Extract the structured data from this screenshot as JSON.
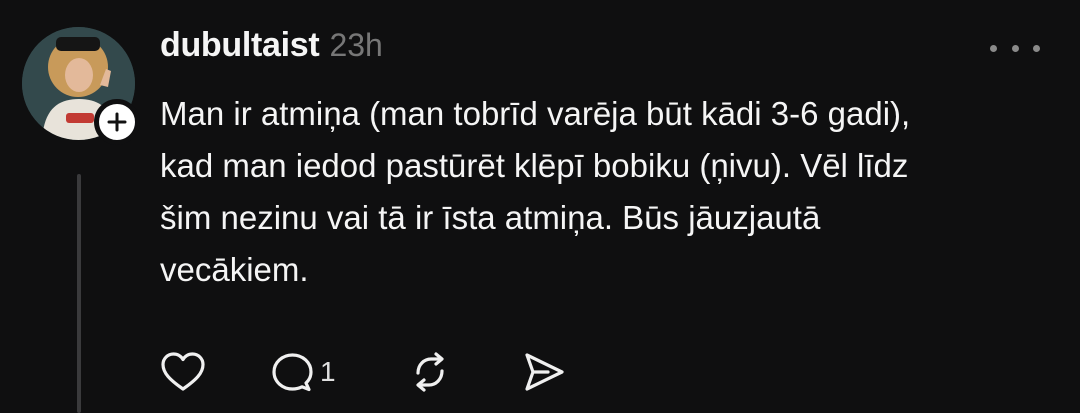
{
  "post": {
    "username": "dubultaist",
    "timestamp": "23h",
    "text_lines": [
      "Man ir atmiņa (man tobrīd varēja būt kādi 3-6 gadi),",
      "kad man iedod pastūrēt klēpī bobiku (ņivu). Vēl līdz",
      "šim nezinu vai tā ir īsta atmiņa. Būs jāuzjautā",
      "vecākiem."
    ],
    "reply_count": "1"
  },
  "icons": {
    "more": "more-horizontal-icon",
    "follow": "plus-icon",
    "like": "heart-icon",
    "reply": "comment-icon",
    "repost": "repost-icon",
    "share": "send-icon"
  },
  "colors": {
    "background": "#0f0f10",
    "text": "#f5f5f5",
    "muted": "#777777",
    "thread_line": "#3a3a3c"
  }
}
